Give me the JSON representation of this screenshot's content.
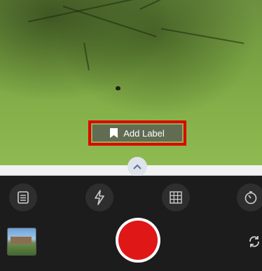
{
  "viewfinder": {
    "add_label_text": "Add Label"
  },
  "controls": {
    "notes_icon": "notes-icon",
    "flash_icon": "flash-off-icon",
    "grid_icon": "grid-icon",
    "timer_icon": "timer-icon",
    "expand_icon": "chevron-up-icon",
    "switch_icon": "switch-camera-icon"
  },
  "colors": {
    "highlight": "#e00000",
    "shutter": "#e01717"
  }
}
